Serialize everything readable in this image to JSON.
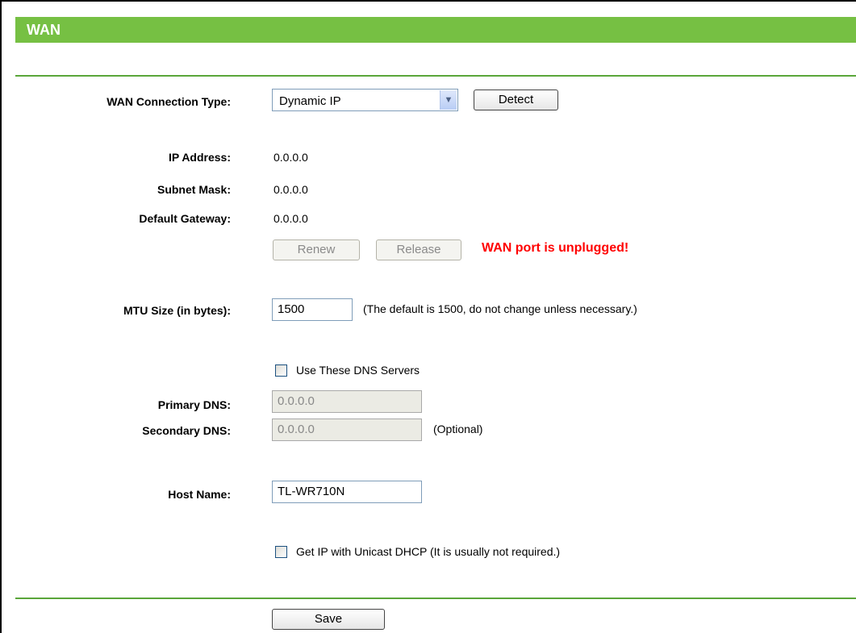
{
  "header": {
    "title": "WAN"
  },
  "connection": {
    "label": "WAN Connection Type:",
    "selected": "Dynamic IP",
    "detect_label": "Detect"
  },
  "status": {
    "ip_label": "IP Address:",
    "ip_value": "0.0.0.0",
    "mask_label": "Subnet Mask:",
    "mask_value": "0.0.0.0",
    "gateway_label": "Default Gateway:",
    "gateway_value": "0.0.0.0",
    "renew_label": "Renew",
    "release_label": "Release",
    "warning": "WAN port is unplugged!"
  },
  "mtu": {
    "label": "MTU Size (in bytes):",
    "value": "1500",
    "hint": "(The default is 1500, do not change unless necessary.)"
  },
  "dns": {
    "checkbox_label": "Use These DNS Servers",
    "primary_label": "Primary DNS:",
    "primary_value": "0.0.0.0",
    "secondary_label": "Secondary DNS:",
    "secondary_value": "0.0.0.0",
    "optional": "(Optional)"
  },
  "host": {
    "label": "Host Name:",
    "value": "TL-WR710N"
  },
  "unicast": {
    "checkbox_label": "Get IP with Unicast DHCP (It is usually not required.)"
  },
  "footer": {
    "save_label": "Save"
  },
  "colors": {
    "header": "#76c043",
    "warning": "#ff0000"
  }
}
